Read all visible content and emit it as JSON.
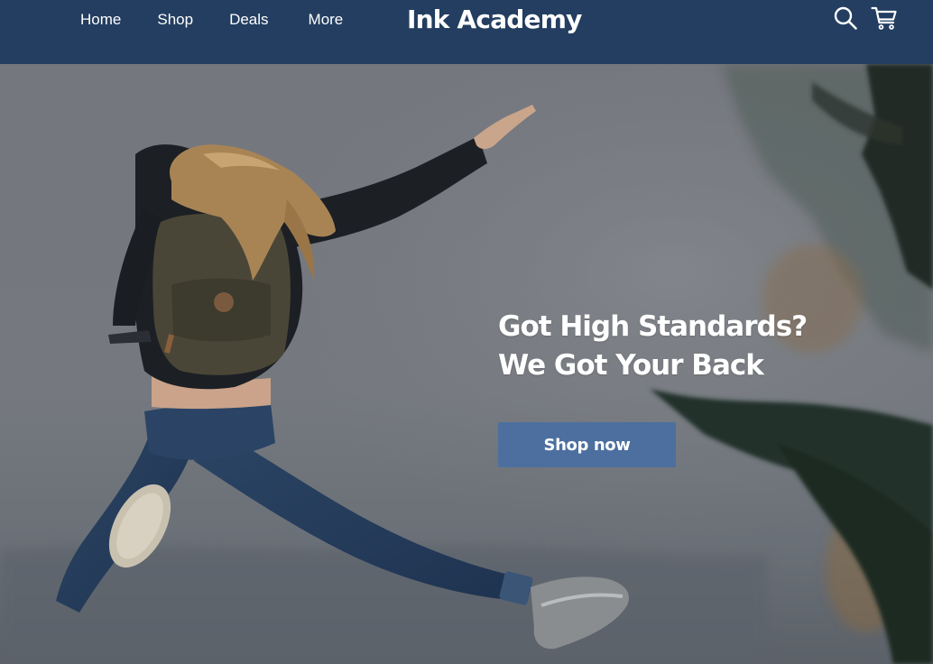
{
  "nav": {
    "links": [
      {
        "label": "Home"
      },
      {
        "label": "Shop"
      },
      {
        "label": "Deals"
      },
      {
        "label": "More"
      }
    ],
    "brand": "Ink Academy",
    "icons": [
      "search-icon",
      "cart-icon"
    ]
  },
  "hero": {
    "headline_line1": "Got High Standards?",
    "headline_line2": "We Got Your Back",
    "cta_label": "Shop now",
    "image": "woman-jumping-with-backpack-photo"
  },
  "colors": {
    "nav_bg": "#233e60",
    "cta_bg": "#4c6f9f",
    "text": "#ffffff"
  }
}
